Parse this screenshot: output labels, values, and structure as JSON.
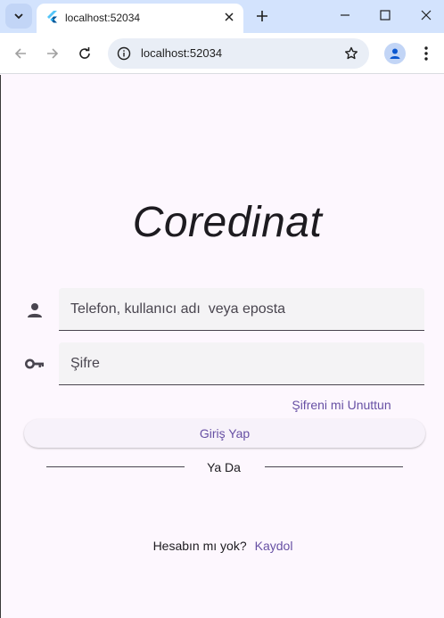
{
  "browser": {
    "tab_title": "localhost:52034",
    "url": "localhost:52034",
    "icons": [
      "tab-search-icon",
      "flutter-favicon-icon",
      "close-icon",
      "plus-icon",
      "minimize-icon",
      "maximize-icon",
      "window-close-icon",
      "back-arrow-icon",
      "forward-arrow-icon",
      "reload-icon",
      "site-info-icon",
      "star-icon",
      "profile-icon",
      "kebab-menu-icon"
    ]
  },
  "login": {
    "title": "Coredinat",
    "username_placeholder": "Telefon, kullanıcı adı  veya eposta",
    "password_placeholder": "Şifre",
    "forgot_password": "Şifreni mi Unuttun",
    "login_button": "Giriş Yap",
    "or_label": "Ya Da",
    "signup_question": "Hesabın mı yok?",
    "signup_link": "Kaydol"
  },
  "colors": {
    "background": "#fdf7fe",
    "primary": "#6750a4",
    "field_fill": "#f4f3f5",
    "tabbar": "#d3e3fd"
  }
}
